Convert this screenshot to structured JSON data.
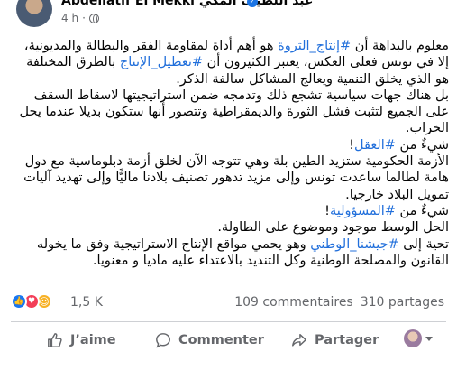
{
  "post_header": {
    "author": "Abdellatif El Mekki عبد اللطيف المكي",
    "time": "4 h",
    "separator": "·"
  },
  "post_body": {
    "p1_line1_pre": "معلوم بالبداهة أن ",
    "p1_tag1": "#إنتاج_الثروة",
    "p1_line1_post": " هو أهم أداة لمقاومة الفقر والبطالة والمديونية، إلا في تونس فعلى العكس، يعتبر الكثيرون أن ",
    "p1_tag2": "#تعطيل_الإنتاج",
    "p1_line_end": " بالطرق المختلفة هو الذي يخلق التنمية ويعالج المشاكل سالفة الذكر.",
    "p2": "بل هناك جهات سياسية تشجع ذلك وتدمجه ضمن استراتيجيتها لاسقاط السقف على الجميع لتثبت فشل الثورة والديمقراطية وتتصور أنها ستكون بديلا عندما يحل الخراب.",
    "p3_pre": "شيءٌ من ",
    "p3_tag": "#العقل",
    "p3_post": "!",
    "p4": "الأزمة الحكومية ستزيد الطين بلة وهي تتوجه الآن لخلق أزمة دبلوماسية مع دول هامة لطالما ساعدت تونس وإلى مزيد تدهور تصنيف بلادنا ماليًّا وإلى تهديد آليات تمويل البلاد خارجيا.",
    "p5_pre": "شيءٌ من ",
    "p5_tag": "#المسؤولية",
    "p5_post": "!",
    "p6": "الحل الوسط موجود وموضوع على الطاولة.",
    "p7_pre": "تحية إلى ",
    "p7_tag": "#جيشنا_الوطني",
    "p7_post": " وهو يحمي مواقع الإنتاج الاستراتيجية وفق ما يخوله القانون والمصلحة الوطنية وكل التنديد بالاعتداء عليه ماديا و معنويا."
  },
  "stats": {
    "reactions_count": "1,5 K",
    "comments": "109 commentaires",
    "shares": "310 partages",
    "reaction_icons": [
      "like-icon",
      "love-icon",
      "care-icon"
    ]
  },
  "actions": {
    "like_label": "J’aime",
    "comment_label": "Commenter",
    "share_label": "Partager"
  },
  "colors": {
    "hashtag": "#216fdb",
    "like": "#1877f2",
    "love": "#f33e58",
    "care": "#f7b125",
    "muted": "#65676b"
  }
}
